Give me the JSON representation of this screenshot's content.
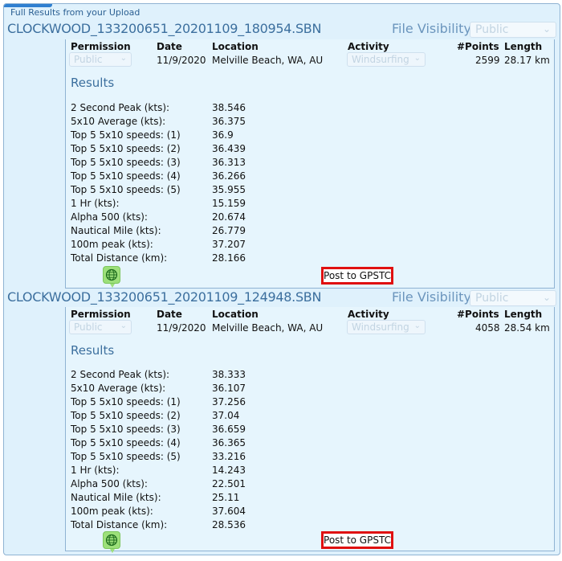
{
  "panel": {
    "header": "Full Results from your Upload"
  },
  "uploads": [
    {
      "filename": "CLOCKWOOD_133200651_20201109_180954.SBN",
      "visibility_label": "File Visibility:",
      "visibility_value": "Public",
      "columns": [
        "Permission",
        "Date",
        "Location",
        "Activity",
        "#Points",
        "Length"
      ],
      "permission": "Public",
      "date": "11/9/2020",
      "location": "Melville Beach, WA, AU",
      "activity": "Windsurfing",
      "points": "2599",
      "length": "28.17 km",
      "results_title": "Results",
      "stats": [
        {
          "label": "2 Second Peak (kts):",
          "value": "38.546"
        },
        {
          "label": "5x10 Average (kts):",
          "value": "36.375"
        },
        {
          "label": "Top 5 5x10 speeds: (1)",
          "value": "36.9"
        },
        {
          "label": "Top 5 5x10 speeds: (2)",
          "value": "36.439"
        },
        {
          "label": "Top 5 5x10 speeds: (3)",
          "value": "36.313"
        },
        {
          "label": "Top 5 5x10 speeds: (4)",
          "value": "36.266"
        },
        {
          "label": "Top 5 5x10 speeds: (5)",
          "value": "35.955"
        },
        {
          "label": "1 Hr (kts):",
          "value": "15.159"
        },
        {
          "label": "Alpha 500 (kts):",
          "value": "20.674"
        },
        {
          "label": "Nautical Mile (kts):",
          "value": "26.779"
        },
        {
          "label": "100m peak (kts):",
          "value": "37.207"
        },
        {
          "label": "Total Distance (km):",
          "value": "28.166"
        }
      ],
      "post_label": "Post to GPSTC"
    },
    {
      "filename": "CLOCKWOOD_133200651_20201109_124948.SBN",
      "visibility_label": "File Visibility:",
      "visibility_value": "Public",
      "columns": [
        "Permission",
        "Date",
        "Location",
        "Activity",
        "#Points",
        "Length"
      ],
      "permission": "Public",
      "date": "11/9/2020",
      "location": "Melville Beach, WA, AU",
      "activity": "Windsurfing",
      "points": "4058",
      "length": "28.54 km",
      "results_title": "Results",
      "stats": [
        {
          "label": "2 Second Peak (kts):",
          "value": "38.333"
        },
        {
          "label": "5x10 Average (kts):",
          "value": "36.107"
        },
        {
          "label": "Top 5 5x10 speeds: (1)",
          "value": "37.256"
        },
        {
          "label": "Top 5 5x10 speeds: (2)",
          "value": "37.04"
        },
        {
          "label": "Top 5 5x10 speeds: (3)",
          "value": "36.659"
        },
        {
          "label": "Top 5 5x10 speeds: (4)",
          "value": "36.365"
        },
        {
          "label": "Top 5 5x10 speeds: (5)",
          "value": "33.216"
        },
        {
          "label": "1 Hr (kts):",
          "value": "14.243"
        },
        {
          "label": "Alpha 500 (kts):",
          "value": "22.501"
        },
        {
          "label": "Nautical Mile (kts):",
          "value": "25.11"
        },
        {
          "label": "100m peak (kts):",
          "value": "37.604"
        },
        {
          "label": "Total Distance (km):",
          "value": "28.536"
        }
      ],
      "post_label": "Post to GPSTC"
    }
  ],
  "icons": {
    "map": "globe-icon",
    "dropdown": "chevron-down-icon"
  },
  "colors": {
    "accent": "#3c6f9e",
    "panel_bg": "#dff1fc",
    "post_border": "#e01010",
    "globe_bg": "#9de07a"
  }
}
